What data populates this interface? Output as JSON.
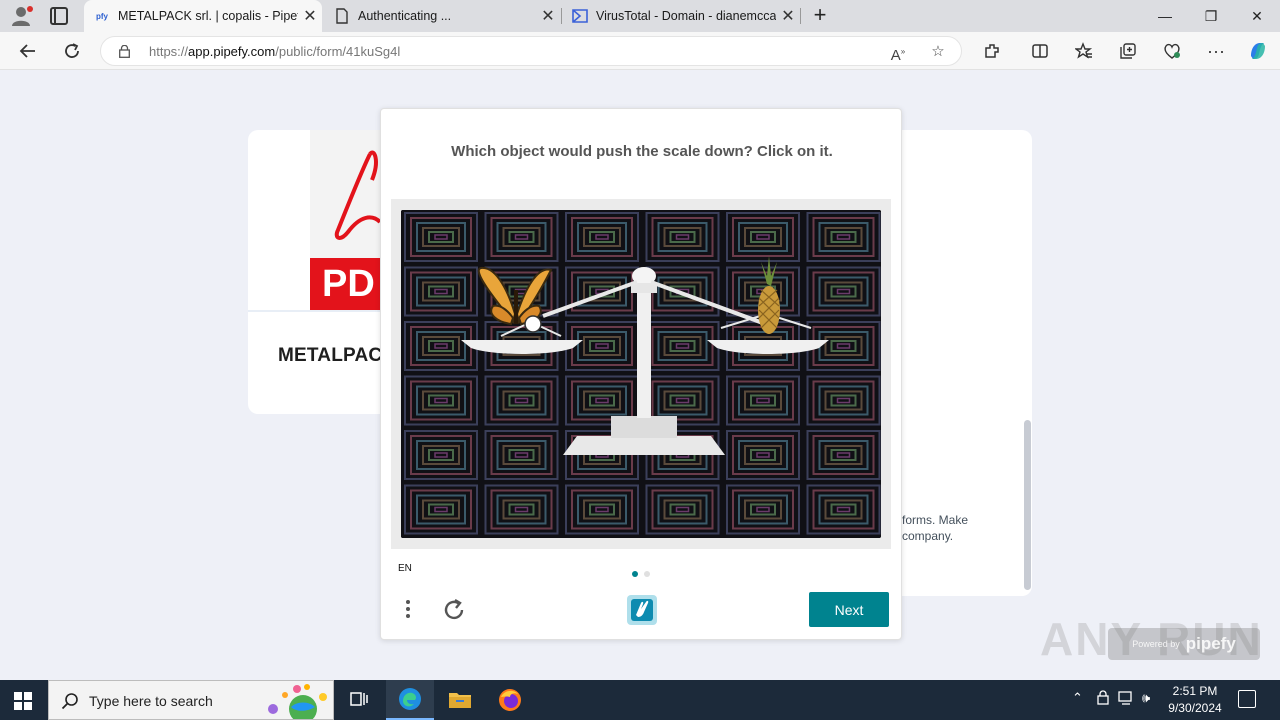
{
  "browser": {
    "tabs": [
      {
        "title": "METALPACK srl. | copalis - Pipefy",
        "favicon": "pfy",
        "active": true
      },
      {
        "title": "Authenticating ...",
        "favicon": "doc-icon",
        "active": false
      },
      {
        "title": "VirusTotal - Domain - dianemcca",
        "favicon": "virustotal-icon",
        "active": false
      }
    ],
    "url_prefix": "https://",
    "url_host": "app.pipefy.com",
    "url_path": "/public/form/41kuSg4l"
  },
  "page": {
    "form_title": "METALPACK",
    "pdf_label": "PD",
    "description_line1": "forms. Make",
    "description_line2": "company.",
    "powered_by_label": "Powered by",
    "powered_by_brand": "pipefy",
    "watermark": "ANY RUN"
  },
  "captcha": {
    "prompt": "Which object would push the scale down? Click on it.",
    "language": "EN",
    "next_label": "Next",
    "page_index": 1,
    "page_count": 2,
    "accent_color": "#00838f"
  },
  "taskbar": {
    "search_placeholder": "Type here to search",
    "time": "2:51 PM",
    "date": "9/30/2024"
  }
}
